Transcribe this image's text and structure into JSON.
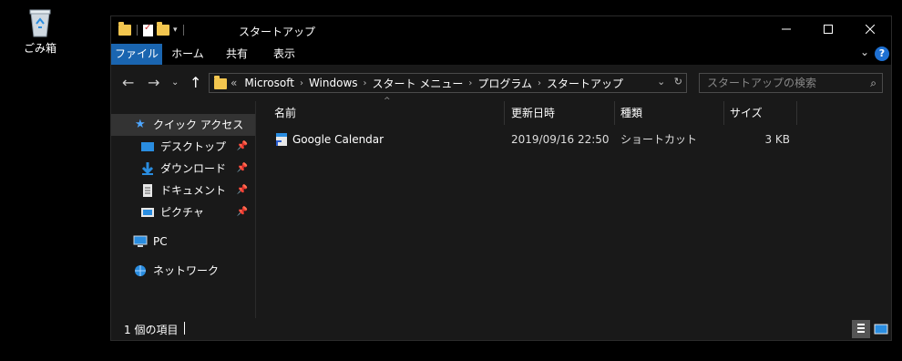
{
  "desktop": {
    "recycle_bin_label": "ごみ箱"
  },
  "window": {
    "title": "スタートアップ",
    "ribbon_tabs": [
      "ファイル",
      "ホーム",
      "共有",
      "表示"
    ],
    "address": {
      "prefix": "«",
      "crumbs": [
        "Microsoft",
        "Windows",
        "スタート メニュー",
        "プログラム",
        "スタートアップ"
      ]
    },
    "search_placeholder": "スタートアップの検索",
    "nav": {
      "quick_access": "クイック アクセス",
      "items": [
        "デスクトップ",
        "ダウンロード",
        "ドキュメント",
        "ピクチャ"
      ],
      "pc": "PC",
      "network": "ネットワーク"
    },
    "columns": [
      "名前",
      "更新日時",
      "種類",
      "サイズ"
    ],
    "rows": [
      {
        "name": "Google Calendar",
        "modified": "2019/09/16 22:50",
        "type": "ショートカット",
        "size": "3 KB"
      }
    ],
    "status": "1 個の項目"
  },
  "colors": {
    "accent": "#1a65b0",
    "background": "#191919",
    "titlebar": "#000000",
    "folder": "#f3c64f"
  }
}
